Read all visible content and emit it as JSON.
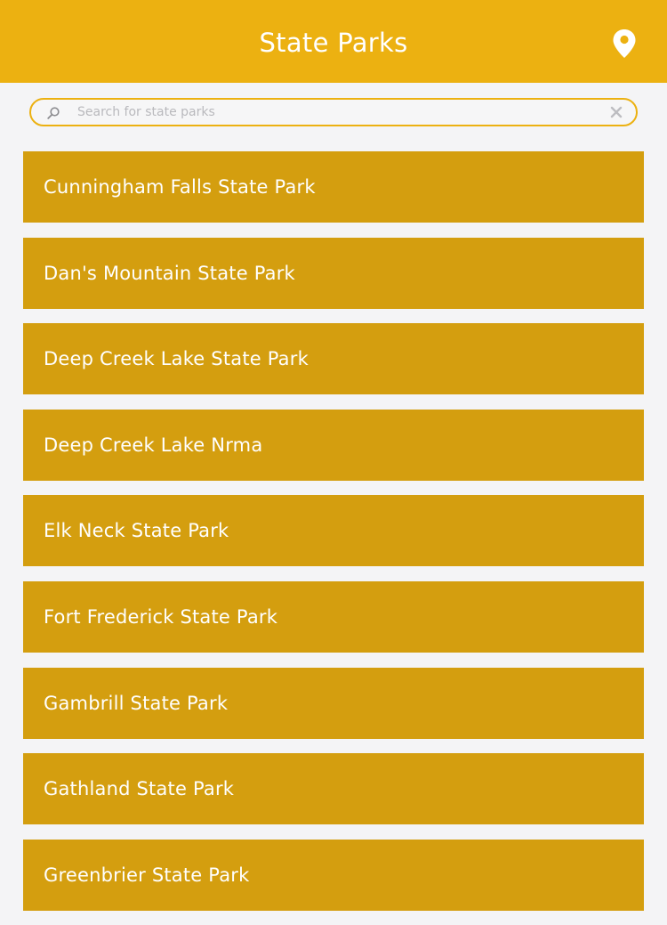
{
  "header": {
    "title": "State Parks",
    "location_icon": "map-pin-icon"
  },
  "search": {
    "placeholder": "Search for state parks",
    "value": "",
    "search_icon": "search-icon",
    "clear_icon": "close-icon"
  },
  "colors": {
    "header": "#ecb111",
    "list_item": "#d49e0f",
    "background": "#f4f4f6",
    "text": "#ffffff"
  },
  "parks": [
    {
      "name": "Cunningham Falls State Park"
    },
    {
      "name": "Dan's Mountain State Park"
    },
    {
      "name": "Deep Creek Lake State Park"
    },
    {
      "name": "Deep Creek Lake Nrma"
    },
    {
      "name": "Elk Neck State Park"
    },
    {
      "name": "Fort Frederick State Park"
    },
    {
      "name": "Gambrill State Park"
    },
    {
      "name": "Gathland State Park"
    },
    {
      "name": "Greenbrier State Park"
    }
  ]
}
